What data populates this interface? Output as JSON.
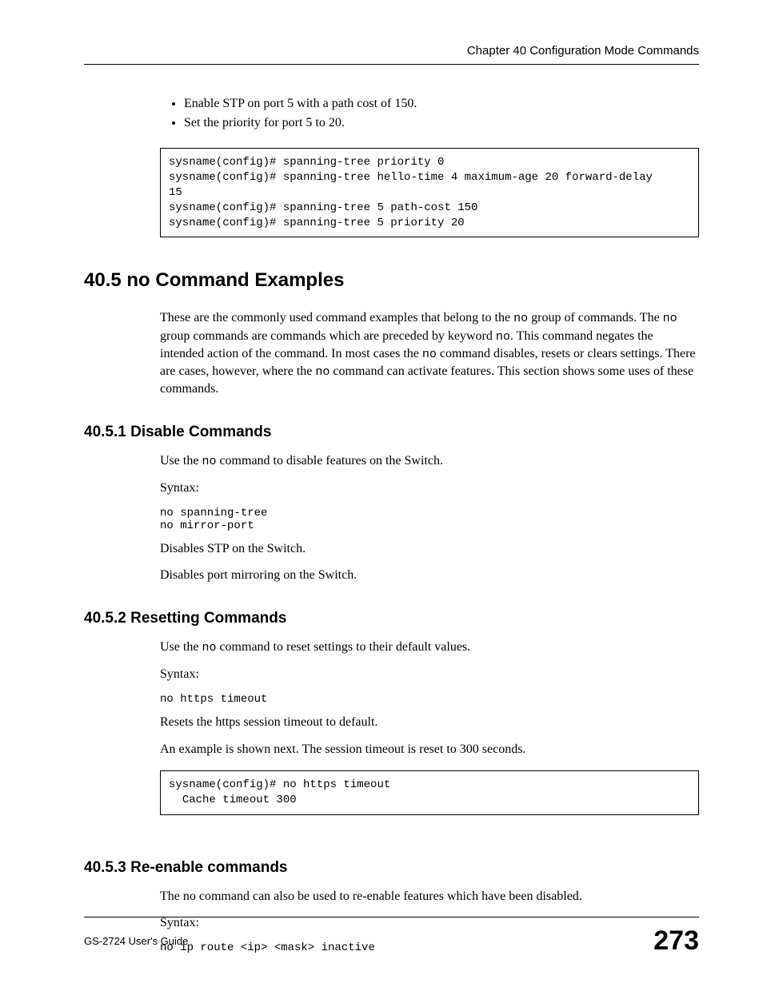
{
  "header": {
    "chapter": "Chapter 40 Configuration Mode Commands"
  },
  "intro": {
    "bullets": [
      "Enable STP on port 5 with a path cost of 150.",
      "Set the priority for port 5 to 20."
    ],
    "codebox": "sysname(config)# spanning-tree priority 0\nsysname(config)# spanning-tree hello-time 4 maximum-age 20 forward-delay\n15\nsysname(config)# spanning-tree 5 path-cost 150\nsysname(config)# spanning-tree 5 priority 20"
  },
  "section405": {
    "title": "40.5  no Command Examples",
    "para_parts": [
      "These are the commonly used command examples that belong to the ",
      "no",
      " group of commands. The ",
      "no",
      " group commands are commands which are preceded by keyword ",
      "no",
      ". This command negates the intended action of the command. In most cases the ",
      "no",
      " command disables, resets or clears settings. There are cases, however, where the ",
      "no",
      " command can activate features. This section shows some uses of these commands."
    ]
  },
  "sub4051": {
    "title": "40.5.1  Disable Commands",
    "p1a": "Use the ",
    "p1b": "no",
    "p1c": " command to disable features on the Switch.",
    "syntax_label": "Syntax:",
    "code": "no spanning-tree\nno mirror-port",
    "p2": "Disables STP on the Switch.",
    "p3": "Disables port mirroring on the Switch."
  },
  "sub4052": {
    "title": "40.5.2  Resetting Commands",
    "p1a": "Use the ",
    "p1b": "no",
    "p1c": " command to reset settings to their default values.",
    "syntax_label": "Syntax:",
    "code": "no https timeout",
    "p2": "Resets the https session timeout to default.",
    "p3": "An example is shown next. The session timeout is reset to 300 seconds.",
    "codebox": "sysname(config)# no https timeout\n  Cache timeout 300"
  },
  "sub4053": {
    "title": "40.5.3  Re-enable commands",
    "p1": "The no command can also be used to re-enable features which have been disabled.",
    "syntax_label": "Syntax:",
    "code": "no ip route <ip> <mask> inactive"
  },
  "footer": {
    "guide": "GS-2724 User's Guide",
    "page": "273"
  }
}
